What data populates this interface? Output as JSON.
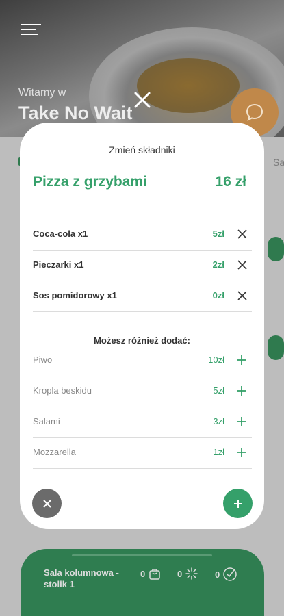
{
  "background": {
    "welcome_text": "Witamy w",
    "venue_name": "Take No Wait",
    "side_text": "Sa"
  },
  "modal": {
    "title": "Zmień składniki",
    "product": {
      "name": "Pizza z grzybami",
      "price": "16 zł"
    },
    "ingredients": [
      {
        "name": "Coca-cola x1",
        "price": "5zł"
      },
      {
        "name": "Pieczarki x1",
        "price": "2zł"
      },
      {
        "name": "Sos pomidorowy x1",
        "price": "0zł"
      }
    ],
    "extras_heading": "Możesz różnież dodać:",
    "extras": [
      {
        "name": "Piwo",
        "price": "10zł"
      },
      {
        "name": "Kropla beskidu",
        "price": "5zł"
      },
      {
        "name": "Salami",
        "price": "3zł"
      },
      {
        "name": "Mozzarella",
        "price": "1zł"
      }
    ]
  },
  "table_bar": {
    "table_name": "Sala kolumnowa - stolik 1",
    "cart_count": "0",
    "pending_count": "0",
    "done_count": "0"
  },
  "colors": {
    "accent_green": "#35a06a",
    "bar_green": "#2f7d50",
    "chat_orange": "#c0884a"
  },
  "icons": {
    "menu": "hamburger-icon",
    "chat": "chat-bubble-icon",
    "close": "close-icon",
    "remove": "x-icon",
    "add": "plus-icon",
    "cart": "shopping-bag-icon",
    "pending": "loading-spinner-icon",
    "done": "check-circle-icon"
  }
}
